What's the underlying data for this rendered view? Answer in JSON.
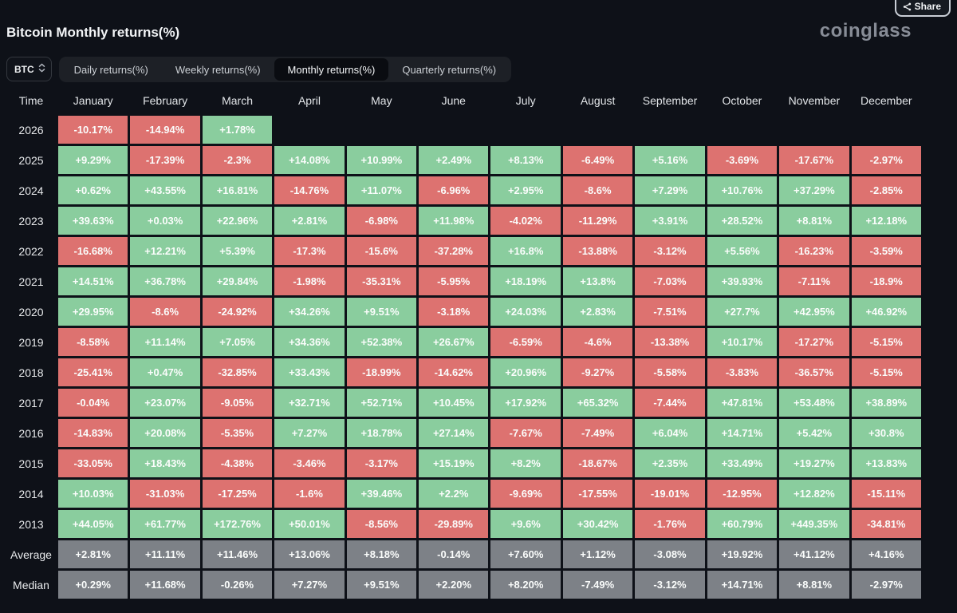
{
  "share": {
    "label": "Share"
  },
  "title": "Bitcoin Monthly returns(%)",
  "brand": "coinglass",
  "symbol_select": {
    "value": "BTC"
  },
  "tabs": [
    {
      "label": "Daily returns(%)",
      "active": false
    },
    {
      "label": "Weekly returns(%)",
      "active": false
    },
    {
      "label": "Monthly returns(%)",
      "active": true
    },
    {
      "label": "Quarterly returns(%)",
      "active": false
    }
  ],
  "colors": {
    "positive": "#8acd9e",
    "negative": "#dd7270",
    "neutral": "#7d8187",
    "background": "#0e1118"
  },
  "table": {
    "time_header": "Time",
    "months": [
      "January",
      "February",
      "March",
      "April",
      "May",
      "June",
      "July",
      "August",
      "September",
      "October",
      "November",
      "December"
    ],
    "rows": [
      {
        "label": "2026",
        "cells": [
          {
            "value": "-10.17%",
            "tone": "neg"
          },
          {
            "value": "-14.94%",
            "tone": "neg"
          },
          {
            "value": "+1.78%",
            "tone": "pos"
          },
          null,
          null,
          null,
          null,
          null,
          null,
          null,
          null,
          null
        ]
      },
      {
        "label": "2025",
        "cells": [
          {
            "value": "+9.29%",
            "tone": "pos"
          },
          {
            "value": "-17.39%",
            "tone": "neg"
          },
          {
            "value": "-2.3%",
            "tone": "neg"
          },
          {
            "value": "+14.08%",
            "tone": "pos"
          },
          {
            "value": "+10.99%",
            "tone": "pos"
          },
          {
            "value": "+2.49%",
            "tone": "pos"
          },
          {
            "value": "+8.13%",
            "tone": "pos"
          },
          {
            "value": "-6.49%",
            "tone": "neg"
          },
          {
            "value": "+5.16%",
            "tone": "pos"
          },
          {
            "value": "-3.69%",
            "tone": "neg"
          },
          {
            "value": "-17.67%",
            "tone": "neg"
          },
          {
            "value": "-2.97%",
            "tone": "neg"
          }
        ]
      },
      {
        "label": "2024",
        "cells": [
          {
            "value": "+0.62%",
            "tone": "pos"
          },
          {
            "value": "+43.55%",
            "tone": "pos"
          },
          {
            "value": "+16.81%",
            "tone": "pos"
          },
          {
            "value": "-14.76%",
            "tone": "neg"
          },
          {
            "value": "+11.07%",
            "tone": "pos"
          },
          {
            "value": "-6.96%",
            "tone": "neg"
          },
          {
            "value": "+2.95%",
            "tone": "pos"
          },
          {
            "value": "-8.6%",
            "tone": "neg"
          },
          {
            "value": "+7.29%",
            "tone": "pos"
          },
          {
            "value": "+10.76%",
            "tone": "pos"
          },
          {
            "value": "+37.29%",
            "tone": "pos"
          },
          {
            "value": "-2.85%",
            "tone": "neg"
          }
        ]
      },
      {
        "label": "2023",
        "cells": [
          {
            "value": "+39.63%",
            "tone": "pos"
          },
          {
            "value": "+0.03%",
            "tone": "pos"
          },
          {
            "value": "+22.96%",
            "tone": "pos"
          },
          {
            "value": "+2.81%",
            "tone": "pos"
          },
          {
            "value": "-6.98%",
            "tone": "neg"
          },
          {
            "value": "+11.98%",
            "tone": "pos"
          },
          {
            "value": "-4.02%",
            "tone": "neg"
          },
          {
            "value": "-11.29%",
            "tone": "neg"
          },
          {
            "value": "+3.91%",
            "tone": "pos"
          },
          {
            "value": "+28.52%",
            "tone": "pos"
          },
          {
            "value": "+8.81%",
            "tone": "pos"
          },
          {
            "value": "+12.18%",
            "tone": "pos"
          }
        ]
      },
      {
        "label": "2022",
        "cells": [
          {
            "value": "-16.68%",
            "tone": "neg"
          },
          {
            "value": "+12.21%",
            "tone": "pos"
          },
          {
            "value": "+5.39%",
            "tone": "pos"
          },
          {
            "value": "-17.3%",
            "tone": "neg"
          },
          {
            "value": "-15.6%",
            "tone": "neg"
          },
          {
            "value": "-37.28%",
            "tone": "neg"
          },
          {
            "value": "+16.8%",
            "tone": "pos"
          },
          {
            "value": "-13.88%",
            "tone": "neg"
          },
          {
            "value": "-3.12%",
            "tone": "neg"
          },
          {
            "value": "+5.56%",
            "tone": "pos"
          },
          {
            "value": "-16.23%",
            "tone": "neg"
          },
          {
            "value": "-3.59%",
            "tone": "neg"
          }
        ]
      },
      {
        "label": "2021",
        "cells": [
          {
            "value": "+14.51%",
            "tone": "pos"
          },
          {
            "value": "+36.78%",
            "tone": "pos"
          },
          {
            "value": "+29.84%",
            "tone": "pos"
          },
          {
            "value": "-1.98%",
            "tone": "neg"
          },
          {
            "value": "-35.31%",
            "tone": "neg"
          },
          {
            "value": "-5.95%",
            "tone": "neg"
          },
          {
            "value": "+18.19%",
            "tone": "pos"
          },
          {
            "value": "+13.8%",
            "tone": "pos"
          },
          {
            "value": "-7.03%",
            "tone": "neg"
          },
          {
            "value": "+39.93%",
            "tone": "pos"
          },
          {
            "value": "-7.11%",
            "tone": "neg"
          },
          {
            "value": "-18.9%",
            "tone": "neg"
          }
        ]
      },
      {
        "label": "2020",
        "cells": [
          {
            "value": "+29.95%",
            "tone": "pos"
          },
          {
            "value": "-8.6%",
            "tone": "neg"
          },
          {
            "value": "-24.92%",
            "tone": "neg"
          },
          {
            "value": "+34.26%",
            "tone": "pos"
          },
          {
            "value": "+9.51%",
            "tone": "pos"
          },
          {
            "value": "-3.18%",
            "tone": "neg"
          },
          {
            "value": "+24.03%",
            "tone": "pos"
          },
          {
            "value": "+2.83%",
            "tone": "pos"
          },
          {
            "value": "-7.51%",
            "tone": "neg"
          },
          {
            "value": "+27.7%",
            "tone": "pos"
          },
          {
            "value": "+42.95%",
            "tone": "pos"
          },
          {
            "value": "+46.92%",
            "tone": "pos"
          }
        ]
      },
      {
        "label": "2019",
        "cells": [
          {
            "value": "-8.58%",
            "tone": "neg"
          },
          {
            "value": "+11.14%",
            "tone": "pos"
          },
          {
            "value": "+7.05%",
            "tone": "pos"
          },
          {
            "value": "+34.36%",
            "tone": "pos"
          },
          {
            "value": "+52.38%",
            "tone": "pos"
          },
          {
            "value": "+26.67%",
            "tone": "pos"
          },
          {
            "value": "-6.59%",
            "tone": "neg"
          },
          {
            "value": "-4.6%",
            "tone": "neg"
          },
          {
            "value": "-13.38%",
            "tone": "neg"
          },
          {
            "value": "+10.17%",
            "tone": "pos"
          },
          {
            "value": "-17.27%",
            "tone": "neg"
          },
          {
            "value": "-5.15%",
            "tone": "neg"
          }
        ]
      },
      {
        "label": "2018",
        "cells": [
          {
            "value": "-25.41%",
            "tone": "neg"
          },
          {
            "value": "+0.47%",
            "tone": "pos"
          },
          {
            "value": "-32.85%",
            "tone": "neg"
          },
          {
            "value": "+33.43%",
            "tone": "pos"
          },
          {
            "value": "-18.99%",
            "tone": "neg"
          },
          {
            "value": "-14.62%",
            "tone": "neg"
          },
          {
            "value": "+20.96%",
            "tone": "pos"
          },
          {
            "value": "-9.27%",
            "tone": "neg"
          },
          {
            "value": "-5.58%",
            "tone": "neg"
          },
          {
            "value": "-3.83%",
            "tone": "neg"
          },
          {
            "value": "-36.57%",
            "tone": "neg"
          },
          {
            "value": "-5.15%",
            "tone": "neg"
          }
        ]
      },
      {
        "label": "2017",
        "cells": [
          {
            "value": "-0.04%",
            "tone": "neg"
          },
          {
            "value": "+23.07%",
            "tone": "pos"
          },
          {
            "value": "-9.05%",
            "tone": "neg"
          },
          {
            "value": "+32.71%",
            "tone": "pos"
          },
          {
            "value": "+52.71%",
            "tone": "pos"
          },
          {
            "value": "+10.45%",
            "tone": "pos"
          },
          {
            "value": "+17.92%",
            "tone": "pos"
          },
          {
            "value": "+65.32%",
            "tone": "pos"
          },
          {
            "value": "-7.44%",
            "tone": "neg"
          },
          {
            "value": "+47.81%",
            "tone": "pos"
          },
          {
            "value": "+53.48%",
            "tone": "pos"
          },
          {
            "value": "+38.89%",
            "tone": "pos"
          }
        ]
      },
      {
        "label": "2016",
        "cells": [
          {
            "value": "-14.83%",
            "tone": "neg"
          },
          {
            "value": "+20.08%",
            "tone": "pos"
          },
          {
            "value": "-5.35%",
            "tone": "neg"
          },
          {
            "value": "+7.27%",
            "tone": "pos"
          },
          {
            "value": "+18.78%",
            "tone": "pos"
          },
          {
            "value": "+27.14%",
            "tone": "pos"
          },
          {
            "value": "-7.67%",
            "tone": "neg"
          },
          {
            "value": "-7.49%",
            "tone": "neg"
          },
          {
            "value": "+6.04%",
            "tone": "pos"
          },
          {
            "value": "+14.71%",
            "tone": "pos"
          },
          {
            "value": "+5.42%",
            "tone": "pos"
          },
          {
            "value": "+30.8%",
            "tone": "pos"
          }
        ]
      },
      {
        "label": "2015",
        "cells": [
          {
            "value": "-33.05%",
            "tone": "neg"
          },
          {
            "value": "+18.43%",
            "tone": "pos"
          },
          {
            "value": "-4.38%",
            "tone": "neg"
          },
          {
            "value": "-3.46%",
            "tone": "neg"
          },
          {
            "value": "-3.17%",
            "tone": "neg"
          },
          {
            "value": "+15.19%",
            "tone": "pos"
          },
          {
            "value": "+8.2%",
            "tone": "pos"
          },
          {
            "value": "-18.67%",
            "tone": "neg"
          },
          {
            "value": "+2.35%",
            "tone": "pos"
          },
          {
            "value": "+33.49%",
            "tone": "pos"
          },
          {
            "value": "+19.27%",
            "tone": "pos"
          },
          {
            "value": "+13.83%",
            "tone": "pos"
          }
        ]
      },
      {
        "label": "2014",
        "cells": [
          {
            "value": "+10.03%",
            "tone": "pos"
          },
          {
            "value": "-31.03%",
            "tone": "neg"
          },
          {
            "value": "-17.25%",
            "tone": "neg"
          },
          {
            "value": "-1.6%",
            "tone": "neg"
          },
          {
            "value": "+39.46%",
            "tone": "pos"
          },
          {
            "value": "+2.2%",
            "tone": "pos"
          },
          {
            "value": "-9.69%",
            "tone": "neg"
          },
          {
            "value": "-17.55%",
            "tone": "neg"
          },
          {
            "value": "-19.01%",
            "tone": "neg"
          },
          {
            "value": "-12.95%",
            "tone": "neg"
          },
          {
            "value": "+12.82%",
            "tone": "pos"
          },
          {
            "value": "-15.11%",
            "tone": "neg"
          }
        ]
      },
      {
        "label": "2013",
        "cells": [
          {
            "value": "+44.05%",
            "tone": "pos"
          },
          {
            "value": "+61.77%",
            "tone": "pos"
          },
          {
            "value": "+172.76%",
            "tone": "pos"
          },
          {
            "value": "+50.01%",
            "tone": "pos"
          },
          {
            "value": "-8.56%",
            "tone": "neg"
          },
          {
            "value": "-29.89%",
            "tone": "neg"
          },
          {
            "value": "+9.6%",
            "tone": "pos"
          },
          {
            "value": "+30.42%",
            "tone": "pos"
          },
          {
            "value": "-1.76%",
            "tone": "neg"
          },
          {
            "value": "+60.79%",
            "tone": "pos"
          },
          {
            "value": "+449.35%",
            "tone": "pos"
          },
          {
            "value": "-34.81%",
            "tone": "neg"
          }
        ]
      },
      {
        "label": "Average",
        "cells": [
          {
            "value": "+2.81%",
            "tone": "avg"
          },
          {
            "value": "+11.11%",
            "tone": "avg"
          },
          {
            "value": "+11.46%",
            "tone": "avg"
          },
          {
            "value": "+13.06%",
            "tone": "avg"
          },
          {
            "value": "+8.18%",
            "tone": "avg"
          },
          {
            "value": "-0.14%",
            "tone": "avg"
          },
          {
            "value": "+7.60%",
            "tone": "avg"
          },
          {
            "value": "+1.12%",
            "tone": "avg"
          },
          {
            "value": "-3.08%",
            "tone": "avg"
          },
          {
            "value": "+19.92%",
            "tone": "avg"
          },
          {
            "value": "+41.12%",
            "tone": "avg"
          },
          {
            "value": "+4.16%",
            "tone": "avg"
          }
        ]
      },
      {
        "label": "Median",
        "cells": [
          {
            "value": "+0.29%",
            "tone": "avg"
          },
          {
            "value": "+11.68%",
            "tone": "avg"
          },
          {
            "value": "-0.26%",
            "tone": "avg"
          },
          {
            "value": "+7.27%",
            "tone": "avg"
          },
          {
            "value": "+9.51%",
            "tone": "avg"
          },
          {
            "value": "+2.20%",
            "tone": "avg"
          },
          {
            "value": "+8.20%",
            "tone": "avg"
          },
          {
            "value": "-7.49%",
            "tone": "avg"
          },
          {
            "value": "-3.12%",
            "tone": "avg"
          },
          {
            "value": "+14.71%",
            "tone": "avg"
          },
          {
            "value": "+8.81%",
            "tone": "avg"
          },
          {
            "value": "-2.97%",
            "tone": "avg"
          }
        ]
      }
    ]
  }
}
